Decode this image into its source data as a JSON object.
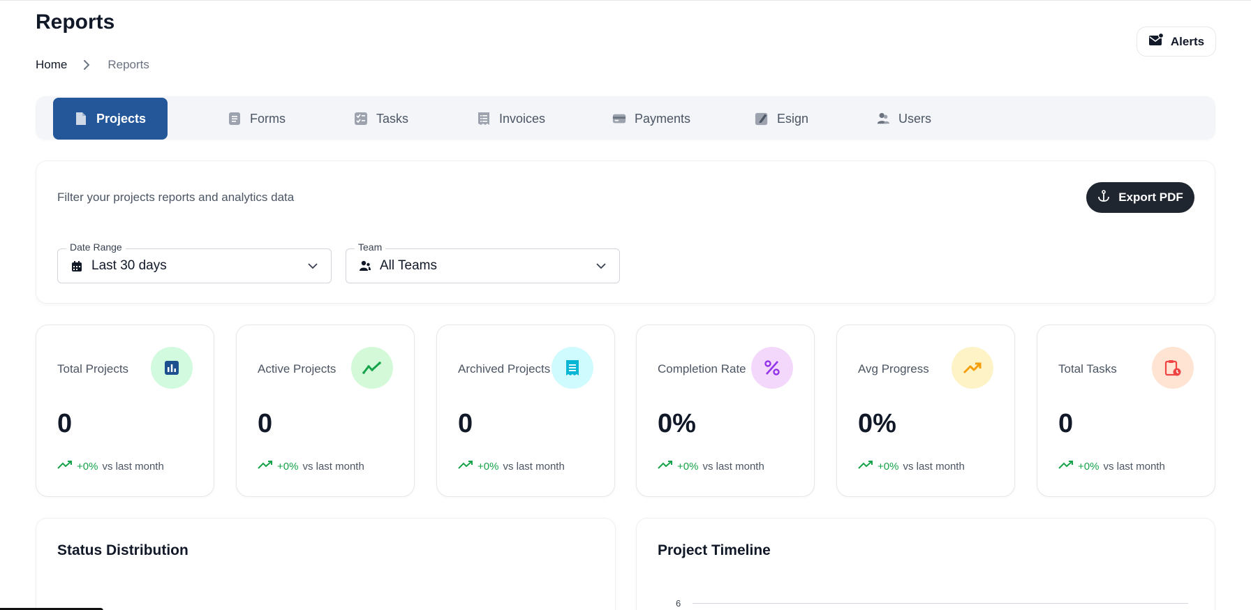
{
  "header": {
    "title": "Reports",
    "breadcrumb": {
      "home": "Home",
      "current": "Reports"
    },
    "alerts_label": "Alerts",
    "alerts_icon": "mail-alert-icon"
  },
  "tabs": [
    {
      "label": "Projects",
      "icon": "file-icon",
      "active": true
    },
    {
      "label": "Forms",
      "icon": "form-icon",
      "active": false
    },
    {
      "label": "Tasks",
      "icon": "checklist-icon",
      "active": false
    },
    {
      "label": "Invoices",
      "icon": "receipt-icon",
      "active": false
    },
    {
      "label": "Payments",
      "icon": "card-icon",
      "active": false
    },
    {
      "label": "Esign",
      "icon": "pen-icon",
      "active": false
    },
    {
      "label": "Users",
      "icon": "users-icon",
      "active": false
    }
  ],
  "filters": {
    "description": "Filter your projects reports and analytics data",
    "export_label": "Export PDF",
    "date_range": {
      "legend": "Date Range",
      "value": "Last 30 days"
    },
    "team": {
      "legend": "Team",
      "value": "All Teams"
    }
  },
  "stats": [
    {
      "label": "Total Projects",
      "value": "0",
      "trend": "+0%",
      "trend_text": "vs last month",
      "icon": "bar-chart-icon",
      "icon_bg": "#d1fadf",
      "icon_color": "#1e4f8f"
    },
    {
      "label": "Active Projects",
      "value": "0",
      "trend": "+0%",
      "trend_text": "vs last month",
      "icon": "trend-line-icon",
      "icon_bg": "#d3f9d8",
      "icon_color": "#16a34a"
    },
    {
      "label": "Archived Projects",
      "value": "0",
      "trend": "+0%",
      "trend_text": "vs last month",
      "icon": "document-icon",
      "icon_bg": "#cffafe",
      "icon_color": "#06b6d4"
    },
    {
      "label": "Completion Rate",
      "value": "0%",
      "trend": "+0%",
      "trend_text": "vs last month",
      "icon": "percent-icon",
      "icon_bg": "#f3d8fb",
      "icon_color": "#9333ea"
    },
    {
      "label": "Avg Progress",
      "value": "0%",
      "trend": "+0%",
      "trend_text": "vs last month",
      "icon": "trending-up-icon",
      "icon_bg": "#fef3c7",
      "icon_color": "#f59e0b"
    },
    {
      "label": "Total Tasks",
      "value": "0",
      "trend": "+0%",
      "trend_text": "vs last month",
      "icon": "clipboard-clock-icon",
      "icon_bg": "#ffe4d3",
      "icon_color": "#ef4444"
    }
  ],
  "panels": {
    "status_title": "Status Distribution",
    "timeline_title": "Project Timeline",
    "timeline_y_tick": "6"
  }
}
